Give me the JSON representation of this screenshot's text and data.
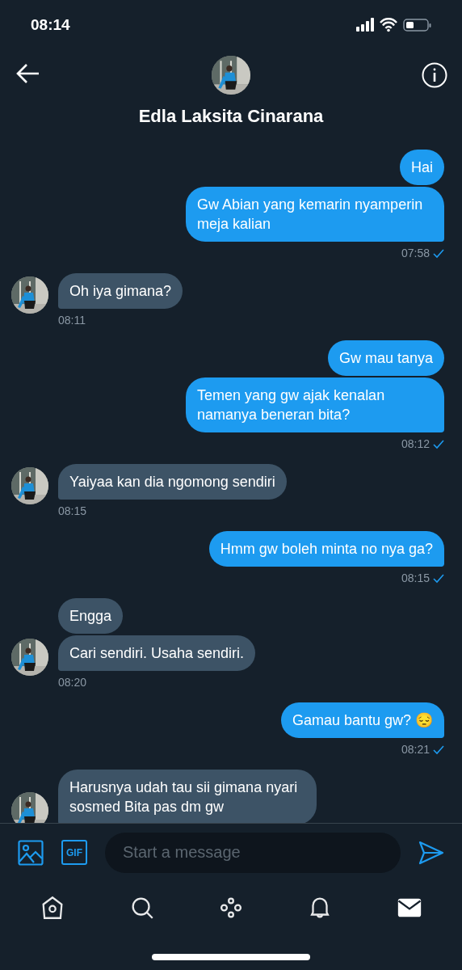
{
  "status_bar": {
    "time": "08:14"
  },
  "header": {
    "name": "Edla Laksita Cinarana"
  },
  "groups": [
    {
      "kind": "sent",
      "messages": [
        "Hai",
        "Gw Abian yang kemarin nyamperin meja kalian"
      ],
      "time": "07:58",
      "read": true
    },
    {
      "kind": "received",
      "messages": [
        "Oh iya gimana?"
      ],
      "time": "08:11"
    },
    {
      "kind": "sent",
      "messages": [
        "Gw mau tanya",
        "Temen yang gw ajak kenalan namanya beneran bita?"
      ],
      "time": "08:12",
      "read": true
    },
    {
      "kind": "received",
      "messages": [
        "Yaiyaa kan dia ngomong sendiri"
      ],
      "time": "08:15"
    },
    {
      "kind": "sent",
      "messages": [
        "Hmm gw boleh minta no nya ga?"
      ],
      "time": "08:15",
      "read": true
    },
    {
      "kind": "received",
      "messages": [
        "Engga",
        "Cari sendiri. Usaha sendiri."
      ],
      "time": "08:20"
    },
    {
      "kind": "sent",
      "messages": [
        "Gamau bantu gw? 😔"
      ],
      "time": "08:21",
      "read": true
    },
    {
      "kind": "received",
      "messages": [
        "Harusnya udah tau sii gimana nyari sosmed Bita pas dm gw"
      ]
    }
  ],
  "composer": {
    "placeholder": "Start a message",
    "gif_label": "GIF"
  },
  "tab_bar": [
    {
      "kind": "home",
      "selected": false
    },
    {
      "kind": "search",
      "selected": false
    },
    {
      "kind": "spaces",
      "selected": false
    },
    {
      "kind": "notifications",
      "selected": false
    },
    {
      "kind": "messages",
      "selected": true
    }
  ]
}
